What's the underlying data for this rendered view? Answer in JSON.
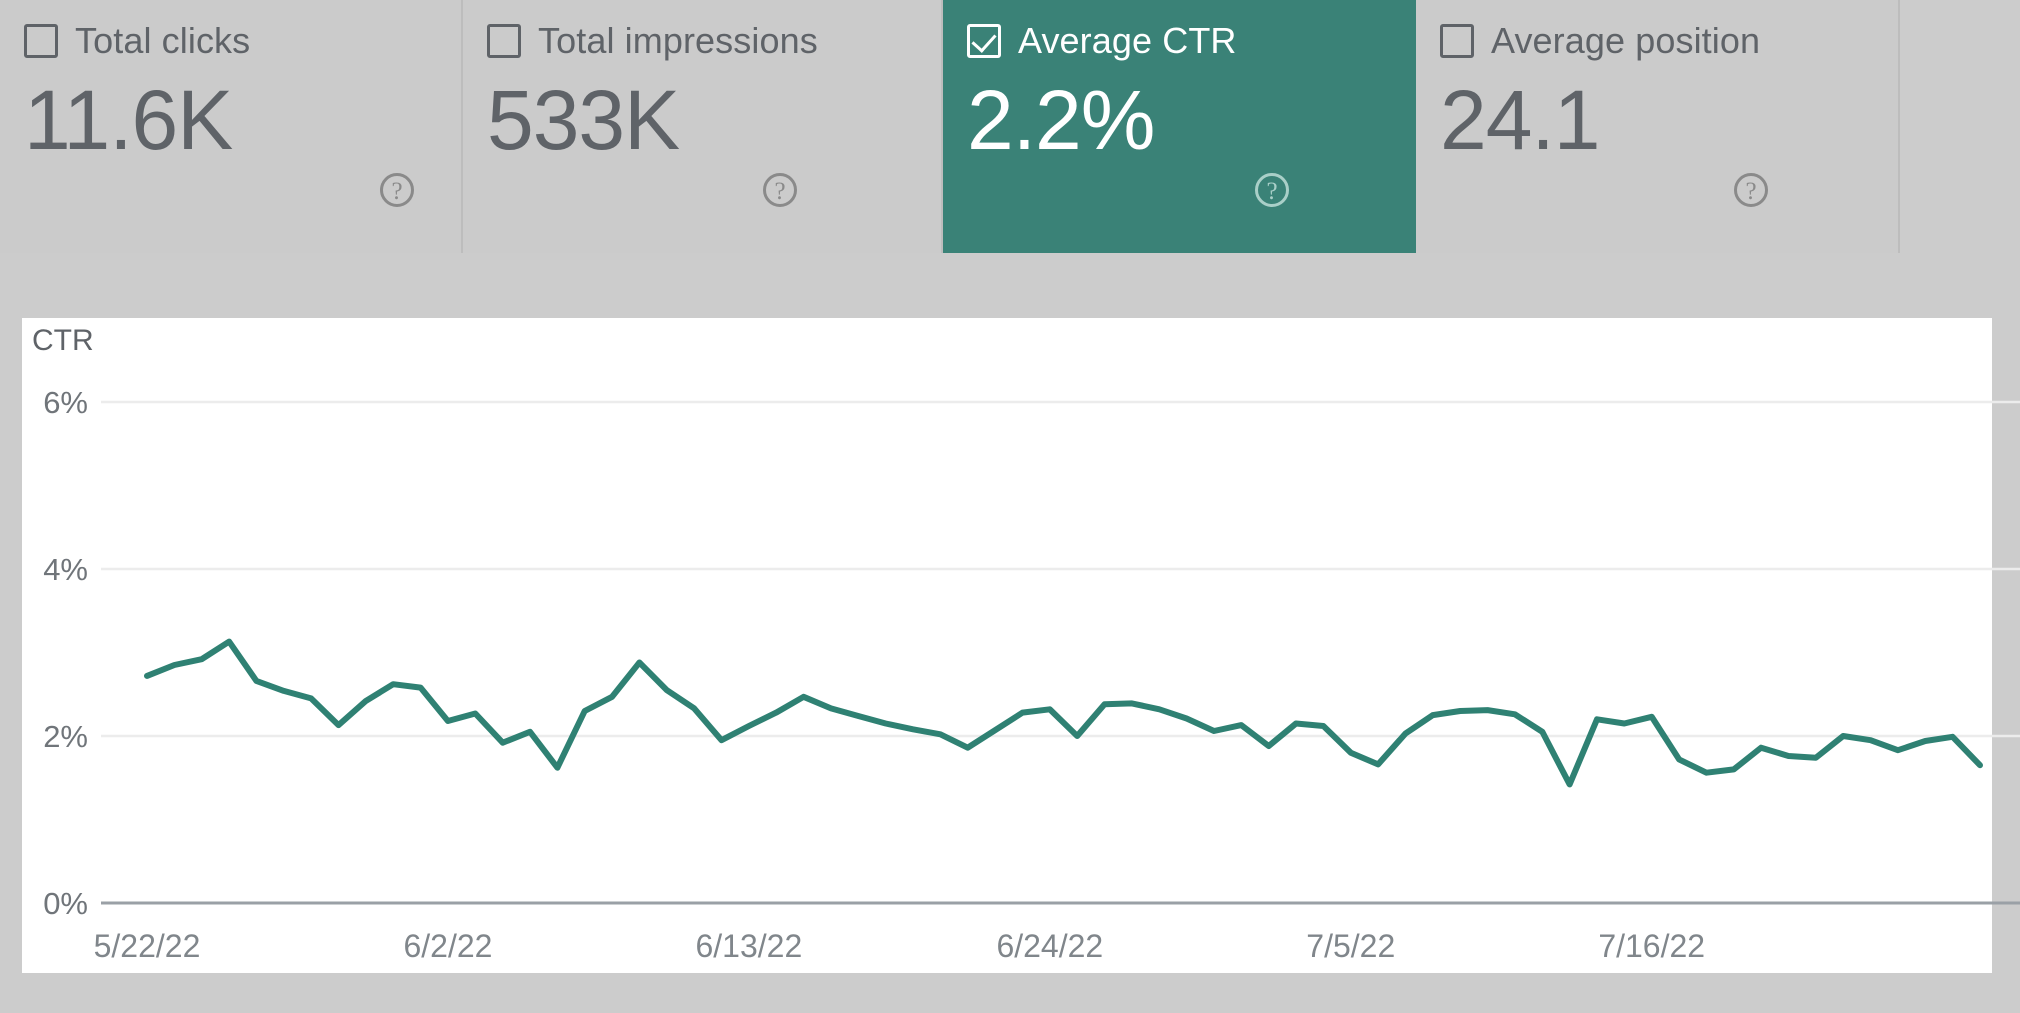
{
  "metrics": [
    {
      "label": "Total clicks",
      "value": "11.6K",
      "selected": false,
      "help": "help-icon"
    },
    {
      "label": "Total impressions",
      "value": "533K",
      "selected": false,
      "help": "help-icon"
    },
    {
      "label": "Average CTR",
      "value": "2.2%",
      "selected": true,
      "help": "help-icon"
    },
    {
      "label": "Average position",
      "value": "24.1",
      "selected": false,
      "help": "help-icon"
    }
  ],
  "colors": {
    "accent": "#3a8277",
    "card_background": "#cbcbcb",
    "page_background": "#cccccc",
    "text": "#5f6368"
  },
  "chart_data": {
    "type": "line",
    "title": "CTR",
    "ylabel": "CTR",
    "xlabel": "",
    "grid": true,
    "legend": "none",
    "series_color": "#2f8173",
    "ylim": [
      0,
      6
    ],
    "ytick_labels": [
      "0%",
      "2%",
      "4%",
      "6%"
    ],
    "ytick_values": [
      0,
      2,
      4,
      6
    ],
    "xtick_labels": [
      "5/22/22",
      "6/2/22",
      "6/13/22",
      "6/24/22",
      "7/5/22",
      "7/16/22"
    ],
    "xtick_indices": [
      0,
      11,
      22,
      33,
      44,
      55
    ],
    "x": [
      "5/22/22",
      "5/23/22",
      "5/24/22",
      "5/25/22",
      "5/26/22",
      "5/27/22",
      "5/28/22",
      "5/29/22",
      "5/30/22",
      "5/31/22",
      "6/1/22",
      "6/2/22",
      "6/3/22",
      "6/4/22",
      "6/5/22",
      "6/6/22",
      "6/7/22",
      "6/8/22",
      "6/9/22",
      "6/10/22",
      "6/11/22",
      "6/12/22",
      "6/13/22",
      "6/14/22",
      "6/15/22",
      "6/16/22",
      "6/17/22",
      "6/18/22",
      "6/19/22",
      "6/20/22",
      "6/21/22",
      "6/22/22",
      "6/23/22",
      "6/24/22",
      "6/25/22",
      "6/26/22",
      "6/27/22",
      "6/28/22",
      "6/29/22",
      "6/30/22",
      "7/1/22",
      "7/2/22",
      "7/3/22",
      "7/4/22",
      "7/5/22",
      "7/6/22",
      "7/7/22",
      "7/8/22",
      "7/9/22",
      "7/10/22",
      "7/11/22",
      "7/12/22",
      "7/13/22",
      "7/14/22",
      "7/15/22",
      "7/16/22",
      "7/17/22",
      "7/18/22",
      "7/19/22",
      "7/20/22",
      "7/21/22",
      "7/22/22",
      "7/23/22",
      "7/24/22",
      "7/25/22",
      "7/26/22",
      "7/27/22",
      "7/28/22"
    ],
    "values": [
      2.72,
      2.85,
      2.92,
      3.13,
      2.66,
      2.54,
      2.45,
      2.13,
      2.42,
      2.62,
      2.58,
      2.18,
      2.27,
      1.92,
      2.05,
      1.62,
      2.3,
      2.47,
      2.88,
      2.55,
      2.33,
      1.95,
      2.12,
      2.28,
      2.47,
      2.33,
      2.24,
      2.15,
      2.08,
      2.02,
      1.86,
      2.07,
      2.28,
      2.32,
      2.0,
      2.38,
      2.39,
      2.32,
      2.21,
      2.06,
      2.13,
      1.88,
      2.15,
      2.12,
      1.8,
      1.66,
      2.03,
      2.25,
      2.3,
      2.31,
      2.26,
      2.05,
      1.42,
      2.2,
      2.15,
      2.23,
      1.72,
      1.56,
      1.6,
      1.86,
      1.76,
      1.74,
      2.0,
      1.95,
      1.83,
      1.94,
      1.99,
      1.65
    ]
  }
}
